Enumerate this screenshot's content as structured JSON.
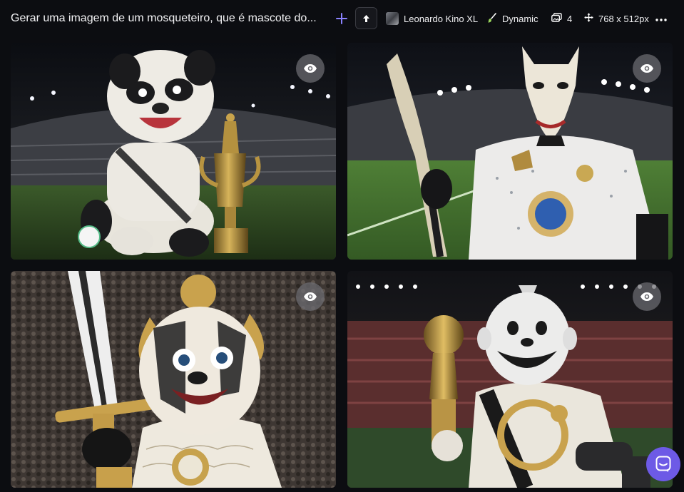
{
  "toolbar": {
    "prompt": "Gerar uma imagem de um mosqueteiro, que é mascote do...",
    "model": "Leonardo Kino XL",
    "style": "Dynamic",
    "image_count": "4",
    "dimensions": "768 x 512px",
    "icons": {
      "plus": "plus-icon",
      "up": "arrow-up-icon",
      "style": "brush-icon",
      "count": "images-icon",
      "dimensions": "move-icon",
      "more": "more-dots-icon"
    }
  },
  "images": [
    {
      "icon": "eye-icon"
    },
    {
      "icon": "eye-icon"
    },
    {
      "icon": "eye-icon"
    },
    {
      "icon": "eye-icon"
    }
  ],
  "colors": {
    "accent": "#8b82ff",
    "chat_button": "#6d5ae6",
    "background": "#0c0d11"
  }
}
